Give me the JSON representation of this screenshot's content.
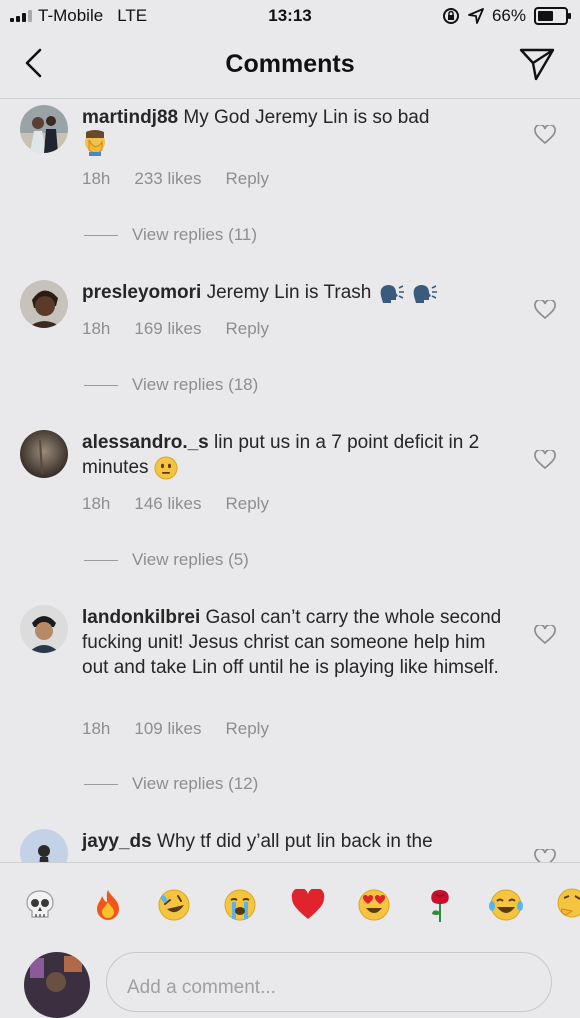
{
  "status": {
    "carrier": "T-Mobile",
    "network": "LTE",
    "time": "13:13",
    "battery": "66%",
    "battery_level": 0.66
  },
  "nav": {
    "title": "Comments"
  },
  "comments": [
    {
      "username": "martindj88",
      "text": "My God Jeremy Lin is so bad",
      "time": "18h",
      "likes": "233 likes",
      "reply": "Reply",
      "view_replies": "View replies (11)"
    },
    {
      "username": "presleyomori",
      "text": "Jeremy Lin is Trash",
      "time": "18h",
      "likes": "169 likes",
      "reply": "Reply",
      "view_replies": "View replies (18)"
    },
    {
      "username": "alessandro._s",
      "text": "lin put us in a 7 point deficit in 2 minutes",
      "time": "18h",
      "likes": "146 likes",
      "reply": "Reply",
      "view_replies": "View replies (5)"
    },
    {
      "username": "landonkilbrei",
      "text": "Gasol can’t carry the whole second fucking unit! Jesus christ can someone help him out and take Lin off until he is playing like himself.",
      "time": "18h",
      "likes": "109 likes",
      "reply": "Reply",
      "view_replies": "View replies (12)"
    },
    {
      "username": "jayy_ds",
      "text": "Why tf did y’all put lin back in the"
    }
  ],
  "emoji_bar": [
    "skull-emoji",
    "fire-emoji",
    "rofl-emoji",
    "crying-emoji",
    "red-heart-emoji",
    "heart-eyes-emoji",
    "rose-emoji",
    "joy-emoji",
    "thinking-emoji"
  ],
  "input": {
    "placeholder": "Add a comment..."
  }
}
